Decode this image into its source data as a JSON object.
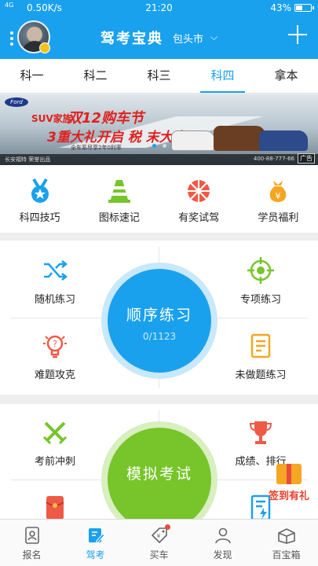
{
  "status_bar": {
    "signal": "4G",
    "network_speed": "0.50K/s",
    "time": "21:20",
    "battery": "43%",
    "battery_level": 0.43
  },
  "app_bar": {
    "title": "驾考宝典",
    "city": "包头市"
  },
  "subject_tabs": [
    {
      "label": "科一",
      "active": false
    },
    {
      "label": "科二",
      "active": false
    },
    {
      "label": "科三",
      "active": false
    },
    {
      "label": "科四",
      "active": true
    },
    {
      "label": "拿本",
      "active": false
    }
  ],
  "banner": {
    "brand": "Ford",
    "line1_prefix": "SUV家族",
    "line1_big": "双12购车节",
    "line2": "3重大礼开启 税 末大惠",
    "line3": "全车系尽享2年0利率",
    "footer_left": "长安福特 荣誉出品",
    "footer_right": "400-88-777-66",
    "ad_label": "广告",
    "page_count": 2,
    "active_page": 1
  },
  "features": [
    {
      "label": "科四技巧",
      "icon": "medal-icon",
      "color": "#1aa1ee"
    },
    {
      "label": "图标速记",
      "icon": "traffic-cone-icon",
      "color": "#77c52a"
    },
    {
      "label": "有奖试驾",
      "icon": "steering-wheel-icon",
      "color": "#ef5a47"
    },
    {
      "label": "学员福利",
      "icon": "money-bag-icon",
      "color": "#f5a623"
    }
  ],
  "practice": {
    "random_label": "随机练习",
    "special_label": "专项练习",
    "difficult_label": "难题攻克",
    "undone_label": "未做题练习",
    "sequential_title": "顺序练习",
    "sequential_progress": "0/1123"
  },
  "exam": {
    "sprint_label": "考前冲刺",
    "scores_label": "成绩、排行",
    "mock_title": "模拟考试"
  },
  "gift": {
    "label": "签到有礼"
  },
  "bottom_nav": [
    {
      "label": "报名",
      "icon": "id-card-icon",
      "active": false
    },
    {
      "label": "驾考",
      "icon": "edit-note-icon",
      "active": true
    },
    {
      "label": "买车",
      "icon": "price-tag-icon",
      "active": false
    },
    {
      "label": "发现",
      "icon": "person-icon",
      "active": false
    },
    {
      "label": "百宝箱",
      "icon": "treasure-box-icon",
      "active": false
    }
  ],
  "colors": {
    "primary": "#1aa1ee",
    "green": "#77c52a",
    "orange": "#f5a623",
    "red": "#ef5a47"
  }
}
